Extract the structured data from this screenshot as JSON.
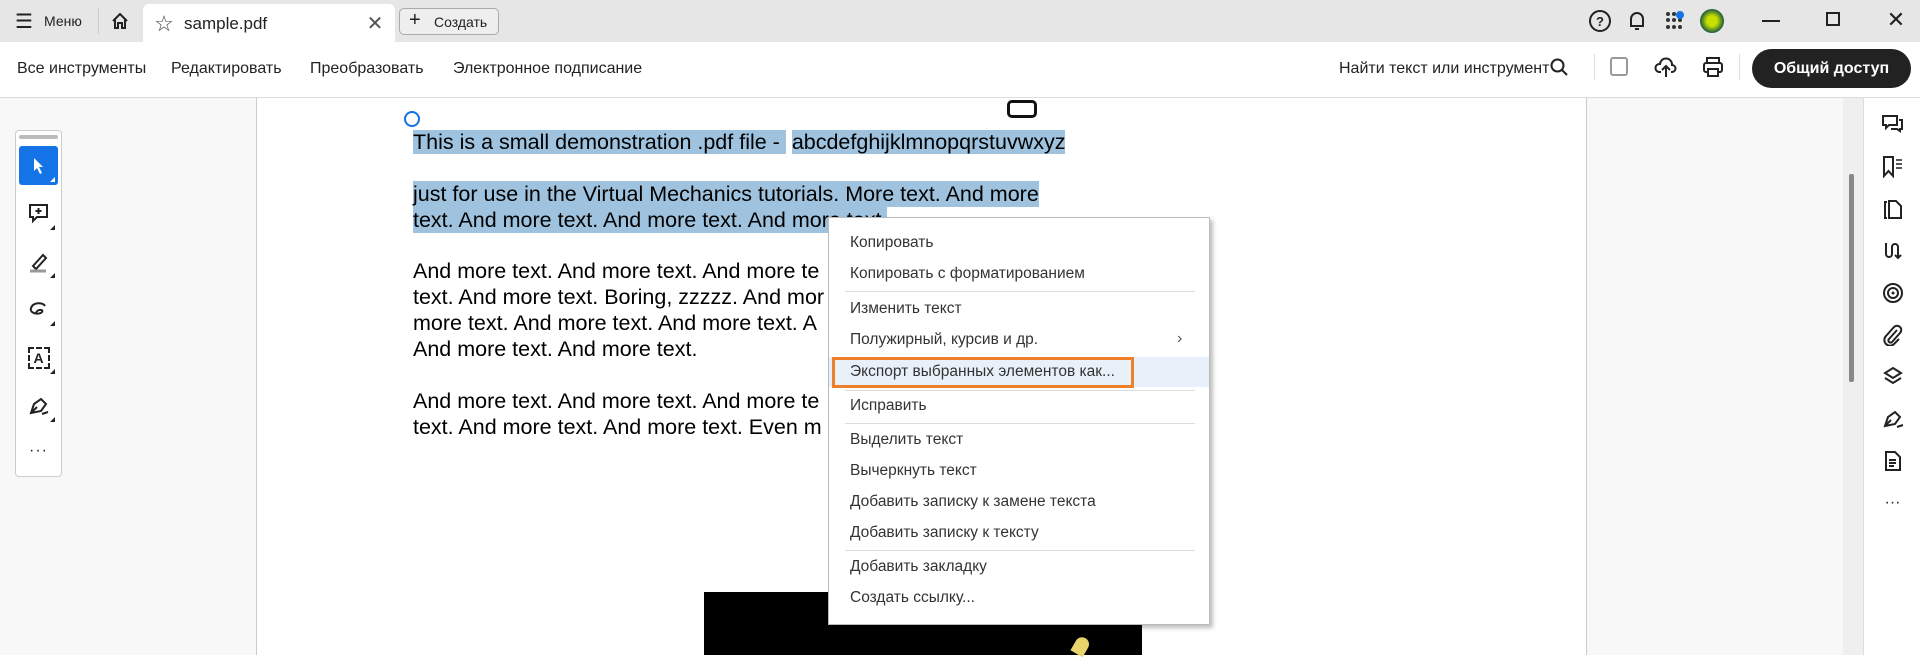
{
  "tabbar": {
    "menu_label": "Меню",
    "tab_title": "sample.pdf",
    "create_label": "Создать"
  },
  "toolbar": {
    "items": [
      "Все инструменты",
      "Редактировать",
      "Преобразовать",
      "Электронное подписание"
    ],
    "search_label": "Найти текст или инструмент",
    "share_label": "Общий доступ"
  },
  "document": {
    "lines": [
      {
        "text": "This is a small demonstration .pdf file - ",
        "sel": true
      },
      {
        "text": "abcdefghijklmnopqrstuvwxyz",
        "sel": true
      },
      {
        "text": "just for use in the Virtual Mechanics tutorials. More text. And more",
        "sel": true
      },
      {
        "text": "text. And more text. And more text. And more text.",
        "sel": true
      },
      {
        "text": "And more text. And more text. And more te"
      },
      {
        "text": "text. And more text. Boring, zzzzz. And mor"
      },
      {
        "text": "more text. And more text. And more text. A"
      },
      {
        "text": "And more text. And more text."
      },
      {
        "text": "And more text. And more text. And more te"
      },
      {
        "text": "text. And more text. And more text. Even m"
      }
    ]
  },
  "context_menu": {
    "items": [
      "Копировать",
      "Копировать с форматированием",
      "Изменить текст",
      "Полужирный, курсив и др.",
      "Экспорт выбранных элементов как...",
      "Исправить",
      "Выделить текст",
      "Вычеркнуть текст",
      "Добавить записку к замене текста",
      "Добавить записку к тексту",
      "Добавить закладку",
      "Создать ссылку..."
    ],
    "highlighted_index": 4
  },
  "colors": {
    "accent": "#1473e6",
    "selection": "#9fc3de",
    "highlight_border": "#f07f2a",
    "share_bg": "#222222"
  }
}
